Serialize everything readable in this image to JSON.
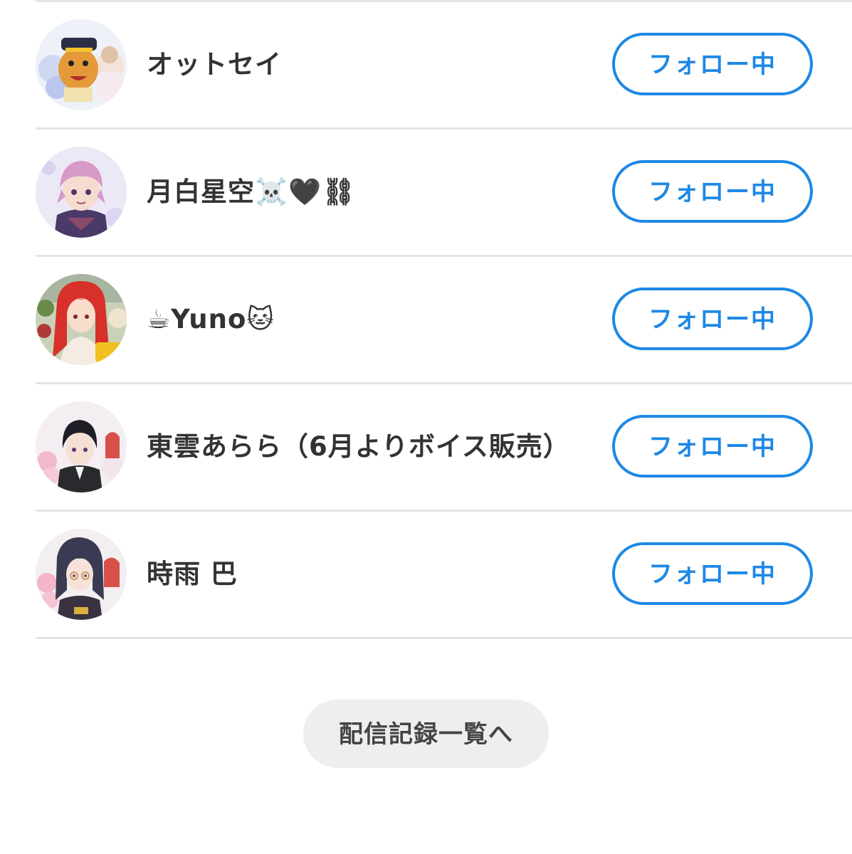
{
  "follow_list": [
    {
      "name": "オットセイ",
      "button_label": "フォロー中",
      "avatar_icon": "otter-character-avatar"
    },
    {
      "name": "月白星空☠️🖤⛓",
      "button_label": "フォロー中",
      "avatar_icon": "pink-hair-boy-avatar"
    },
    {
      "name": "☕Yuno🐱",
      "button_label": "フォロー中",
      "avatar_icon": "red-hair-girl-avatar"
    },
    {
      "name": "東雲あらら（6月よりボイス販売）",
      "button_label": "フォロー中",
      "avatar_icon": "black-hair-boy-avatar"
    },
    {
      "name": "時雨 巴",
      "button_label": "フォロー中",
      "avatar_icon": "dark-hair-girl-avatar"
    }
  ],
  "footer": {
    "records_label": "配信記録一覧へ"
  },
  "colors": {
    "accent": "#1e88e5",
    "text": "#333333",
    "divider": "#e3e3e3",
    "pill_bg": "#eeeeee"
  }
}
